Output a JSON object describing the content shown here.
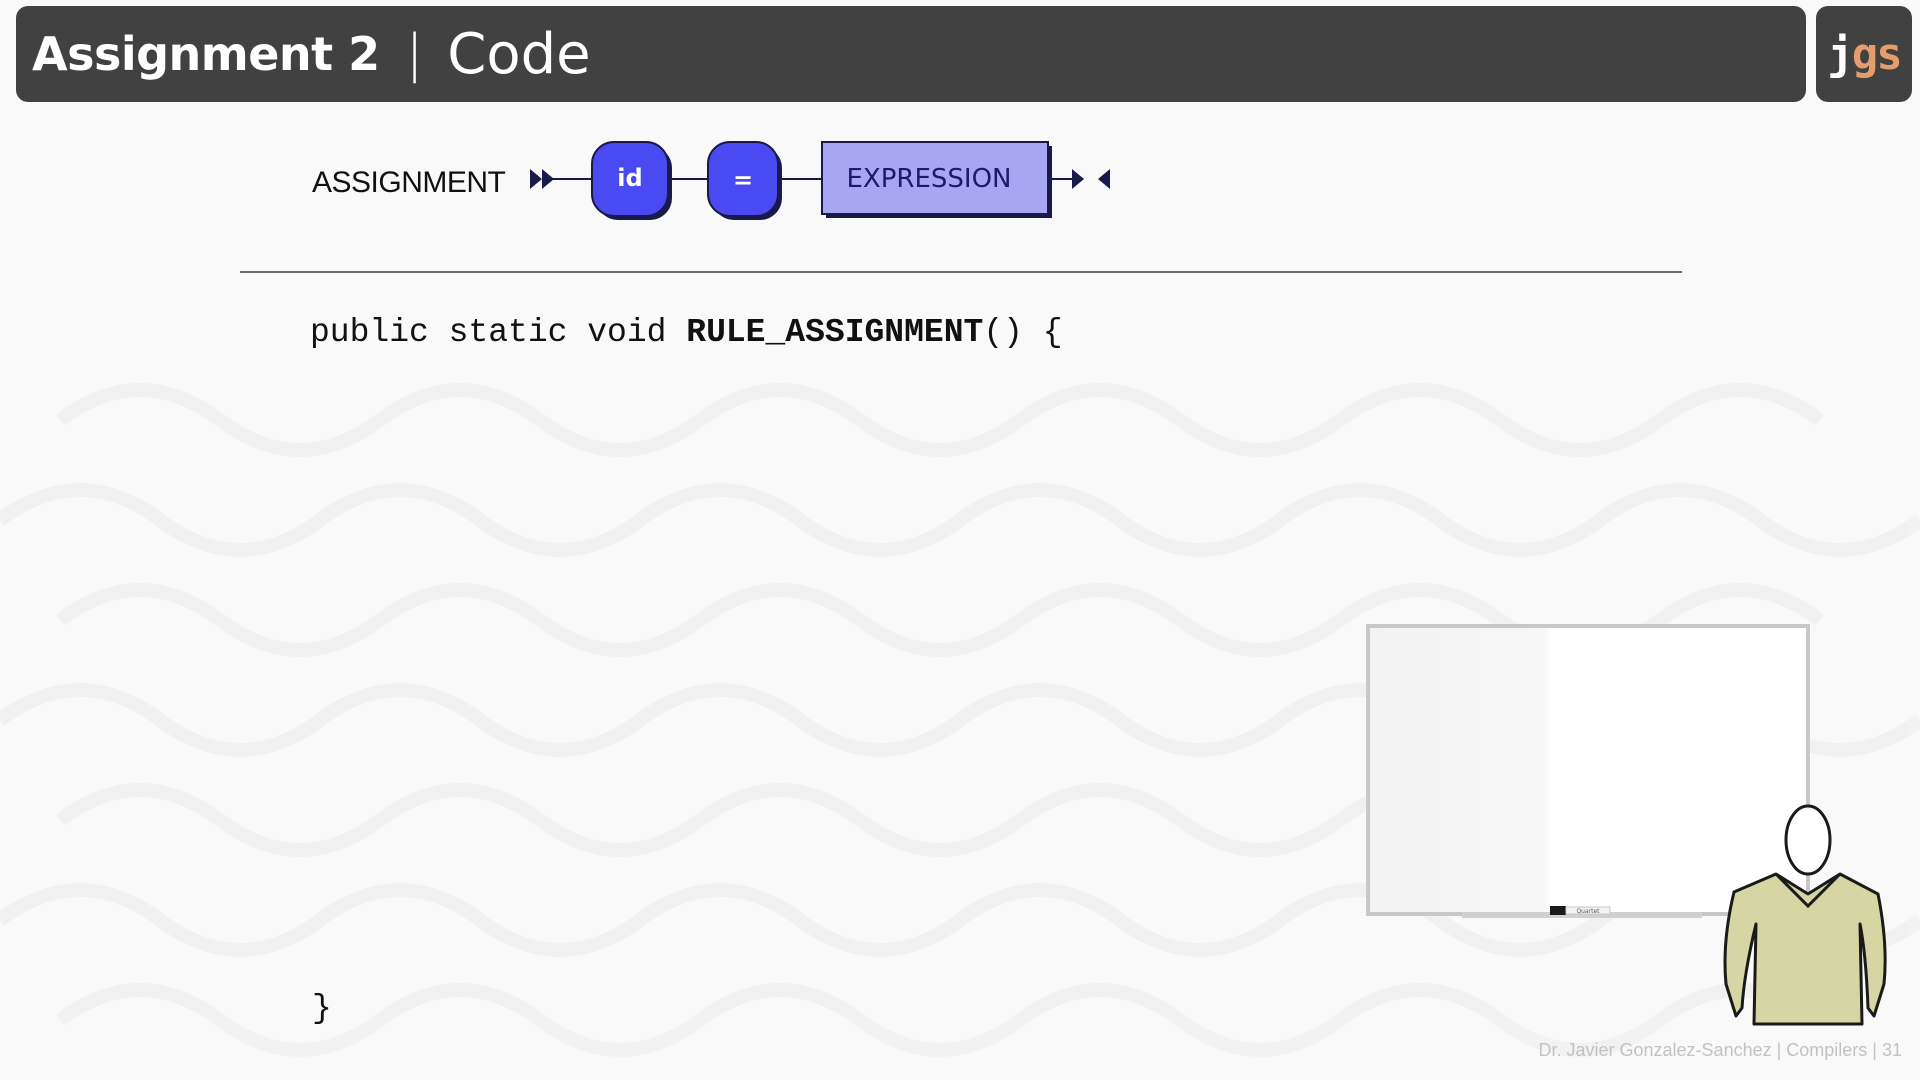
{
  "header": {
    "title": "Assignment 2",
    "separator": "|",
    "subtitle": "Code"
  },
  "logo": {
    "part1": "j",
    "part2": "gs"
  },
  "diagram": {
    "rule_name": "ASSIGNMENT",
    "nodes": [
      {
        "kind": "terminal",
        "label": "id"
      },
      {
        "kind": "terminal",
        "label": "="
      },
      {
        "kind": "nonterminal",
        "label": "EXPRESSION"
      }
    ],
    "colors": {
      "terminal_fill": "#4a4af2",
      "nonterminal_fill": "#a6a6f2",
      "shadow": "#1a1a4a"
    }
  },
  "code": {
    "line1_prefix": "public static void ",
    "line1_method": "RULE_ASSIGNMENT",
    "line1_suffix": "() {",
    "closing_brace": "}"
  },
  "whiteboard": {
    "marker_label": "Quartet"
  },
  "footer": {
    "text": "Dr. Javier Gonzalez-Sanchez | Compilers | 31"
  },
  "colors": {
    "header_bg": "#414141",
    "logo_accent": "#e59d6d"
  }
}
